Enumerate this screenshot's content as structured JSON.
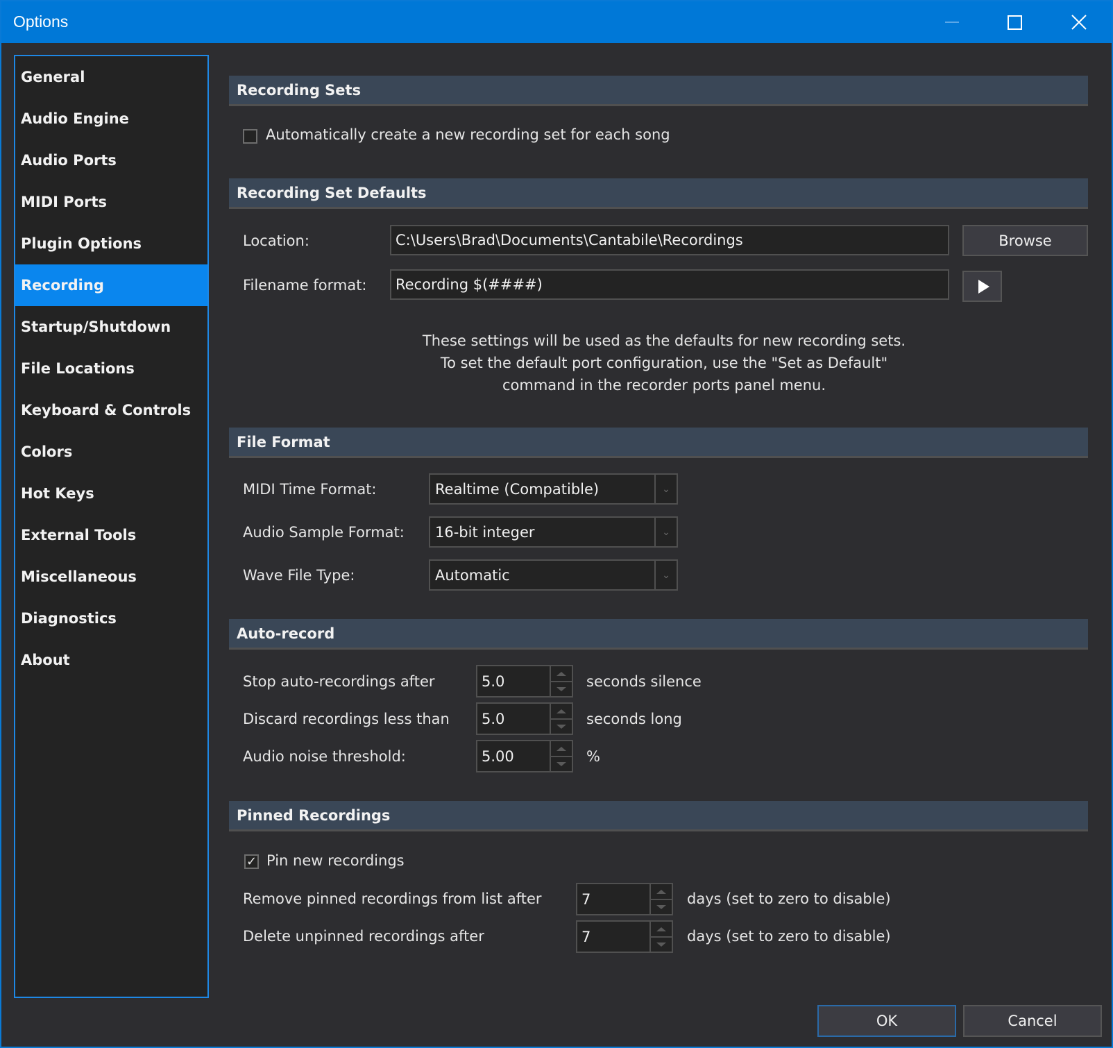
{
  "window": {
    "title": "Options",
    "accent_color": "#0078d7",
    "controls": [
      "minimize",
      "maximize",
      "close"
    ]
  },
  "sidebar": {
    "selected": "Recording",
    "items": [
      {
        "label": "General"
      },
      {
        "label": "Audio Engine"
      },
      {
        "label": "Audio Ports"
      },
      {
        "label": "MIDI Ports"
      },
      {
        "label": "Plugin Options"
      },
      {
        "label": "Recording"
      },
      {
        "label": "Startup/Shutdown"
      },
      {
        "label": "File Locations"
      },
      {
        "label": "Keyboard & Controls"
      },
      {
        "label": "Colors"
      },
      {
        "label": "Hot Keys"
      },
      {
        "label": "External Tools"
      },
      {
        "label": "Miscellaneous"
      },
      {
        "label": "Diagnostics"
      },
      {
        "label": "About"
      }
    ]
  },
  "recording_sets": {
    "header": "Recording Sets",
    "auto_create_label": "Automatically create a new recording set for each song",
    "auto_create_checked": false
  },
  "recording_set_defaults": {
    "header": "Recording Set Defaults",
    "location_label": "Location:",
    "location_value": "C:\\Users\\Brad\\Documents\\Cantabile\\Recordings",
    "browse_label": "Browse",
    "filename_label": "Filename format:",
    "filename_value": "Recording $(####)",
    "info_lines": [
      "These settings will be used as the defaults for new recording sets.",
      "To set the default port configuration, use the \"Set as Default\"",
      "command in the recorder ports panel menu."
    ]
  },
  "file_format": {
    "header": "File Format",
    "midi_time_label": "MIDI Time Format:",
    "midi_time_value": "Realtime (Compatible)",
    "sample_format_label": "Audio Sample Format:",
    "sample_format_value": "16-bit integer",
    "wave_type_label": "Wave File Type:",
    "wave_type_value": "Automatic"
  },
  "auto_record": {
    "header": "Auto-record",
    "stop_label": "Stop auto-recordings after",
    "stop_value": "5.0",
    "stop_unit": "seconds silence",
    "discard_label": "Discard recordings less than",
    "discard_value": "5.0",
    "discard_unit": "seconds long",
    "noise_label": "Audio noise threshold:",
    "noise_value": "5.00",
    "noise_unit": "%"
  },
  "pinned_recordings": {
    "header": "Pinned Recordings",
    "pin_new_label": "Pin new recordings",
    "pin_new_checked": true,
    "remove_label": "Remove pinned recordings from list after",
    "remove_value": "7",
    "remove_unit": "days (set to zero to disable)",
    "delete_label": "Delete unpinned recordings after",
    "delete_value": "7",
    "delete_unit": "days (set to zero to disable)"
  },
  "footer": {
    "ok_label": "OK",
    "cancel_label": "Cancel"
  }
}
